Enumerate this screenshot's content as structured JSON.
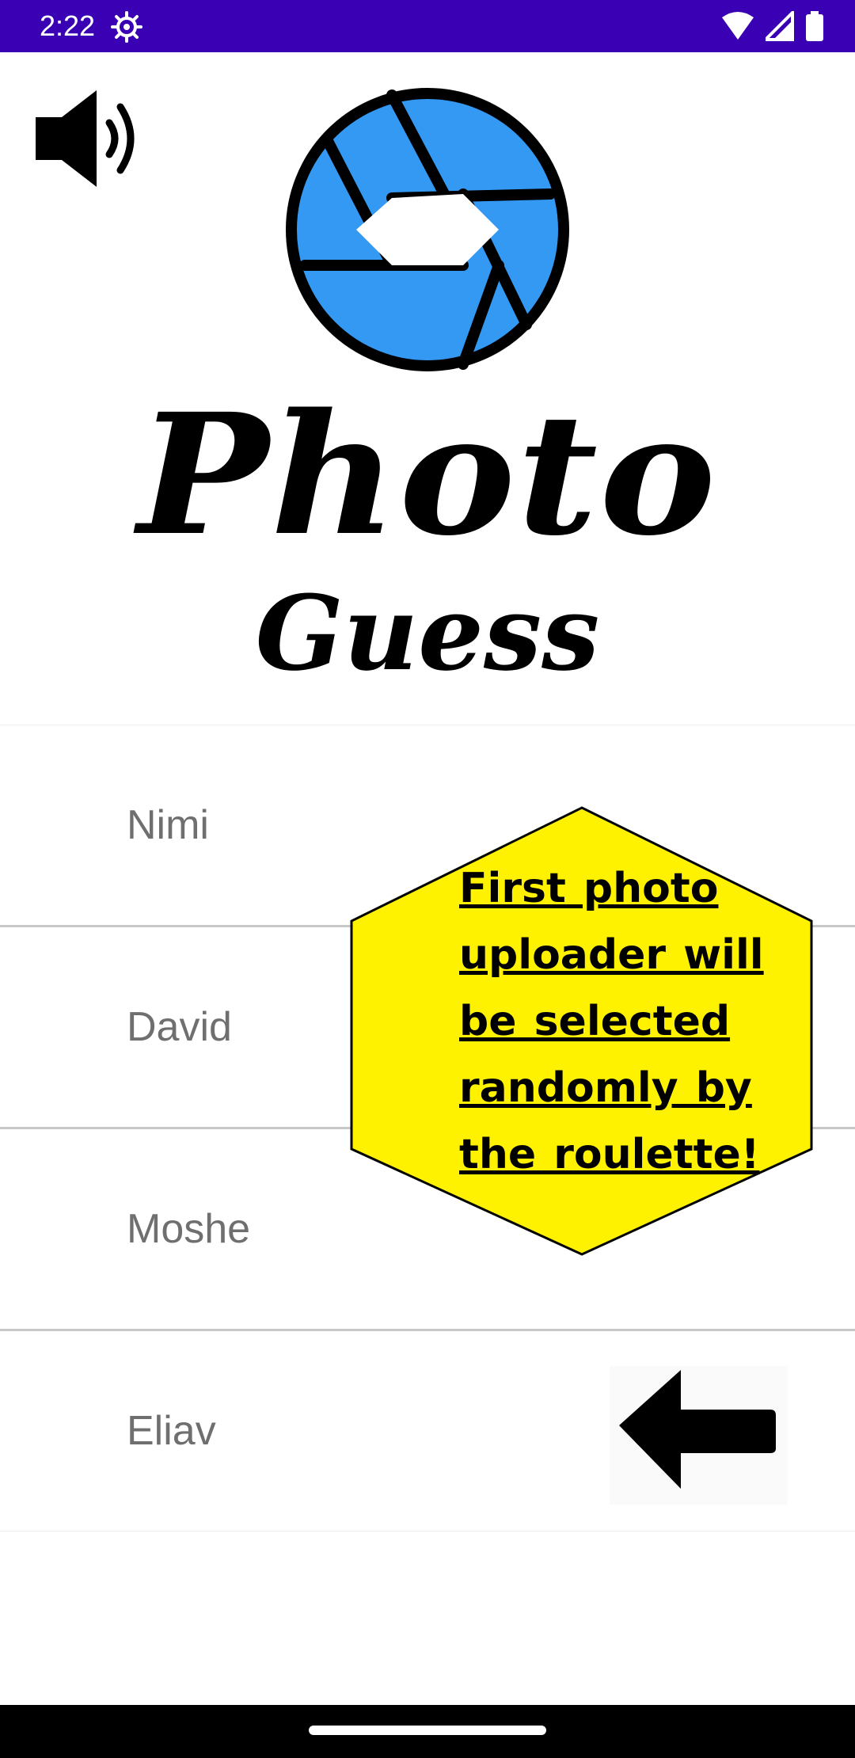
{
  "status_bar": {
    "time": "2:22",
    "icons": [
      "settings-gear-icon",
      "wifi-icon",
      "signal-icon",
      "battery-icon"
    ],
    "background_color": "#3a00b3"
  },
  "header": {
    "sound_icon": "volume-on-icon",
    "logo": {
      "icon": "camera-aperture-icon",
      "title": "Photo",
      "subtitle": "Guess",
      "accent_color": "#3399f3"
    }
  },
  "players": [
    {
      "name": "Nimi"
    },
    {
      "name": "David"
    },
    {
      "name": "Moshe"
    },
    {
      "name": "Eliav"
    }
  ],
  "selection_arrow": {
    "icon": "arrow-left-icon",
    "selected_player": "Eliav"
  },
  "notice": {
    "text": "First photo uploader will be selected randomly by the roulette!",
    "background_color": "#fff200"
  },
  "nav_bar": {
    "handle": "home-gesture-handle"
  }
}
